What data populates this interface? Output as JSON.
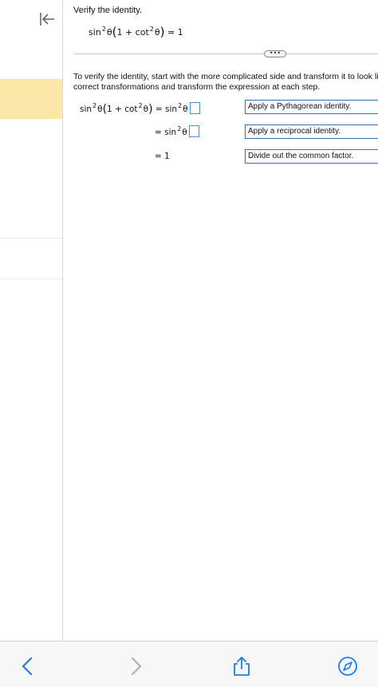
{
  "question": {
    "prompt": "Verify the identity.",
    "identity": {
      "lhs_fn": "sin",
      "power": "2",
      "var": "θ",
      "inner_one": "1 +",
      "inner_fn": "cot",
      "rhs": "= 1"
    }
  },
  "instructions": {
    "line1": "To verify the identity, start with the more complicated side and transform it to look like",
    "line2": "correct transformations and transform the expression at each step."
  },
  "steps": [
    {
      "lhs": "sin",
      "lhs_power": "2",
      "lhs_var": "θ",
      "lhs_inner_one": "1 +",
      "lhs_inner_fn": "cot",
      "rhs_prefix": "= sin",
      "rhs_power": "2",
      "rhs_var": "θ",
      "reason": "Apply a Pythagorean identity."
    },
    {
      "rhs_prefix": "= sin",
      "rhs_power": "2",
      "rhs_var": "θ",
      "reason": "Apply a reciprocal identity."
    },
    {
      "rhs_prefix": "= 1",
      "reason": "Divide out the common factor."
    }
  ],
  "toolbar": {
    "more_label": "•••"
  },
  "icons": {
    "collapse": "collapse-left-icon",
    "back": "chevron-left-icon",
    "forward": "chevron-right-icon",
    "share": "share-icon",
    "browser": "compass-icon"
  },
  "colors": {
    "accent": "#1a7cf5",
    "highlight": "#fbe8a8",
    "reason_border": "#3a6fb7"
  }
}
